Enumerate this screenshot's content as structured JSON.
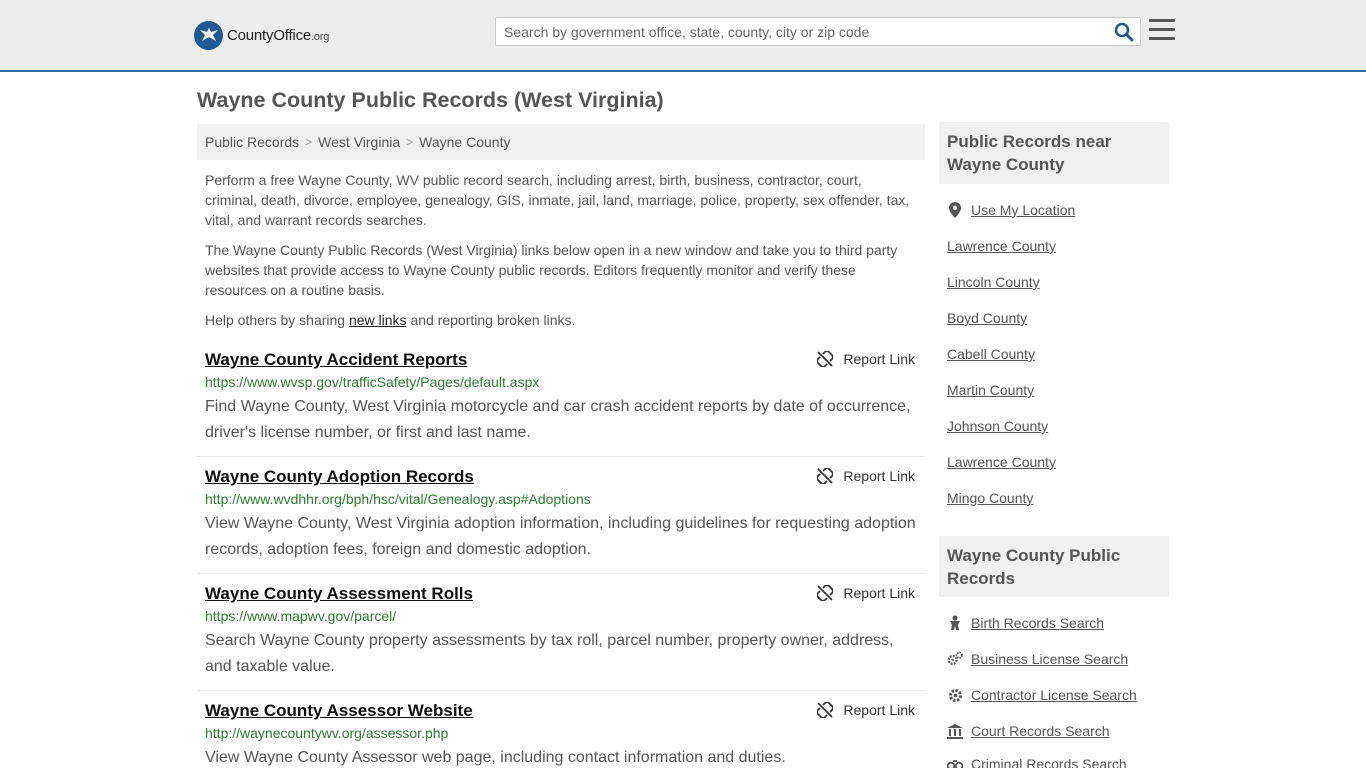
{
  "header": {
    "logo_county": "County",
    "logo_office": "Office",
    "logo_org": ".org",
    "search_placeholder": "Search by government office, state, county, city or zip code"
  },
  "page": {
    "title": "Wayne County Public Records (West Virginia)"
  },
  "breadcrumb": [
    "Public Records",
    "West Virginia",
    "Wayne County"
  ],
  "intro": {
    "p1": "Perform a free Wayne County, WV public record search, including arrest, birth, business, contractor, court, criminal, death, divorce, employee, genealogy, GIS, inmate, jail, land, marriage, police, property, sex offender, tax, vital, and warrant records searches.",
    "p2": "The Wayne County Public Records (West Virginia) links below open in a new window and take you to third party websites that provide access to Wayne County public records. Editors frequently monitor and verify these resources on a routine basis.",
    "p3_before": "Help others by sharing ",
    "p3_link": "new links",
    "p3_after": " and reporting broken links."
  },
  "report_label": "Report Link",
  "records": [
    {
      "title": "Wayne County Accident Reports",
      "url": "https://www.wvsp.gov/trafficSafety/Pages/default.aspx",
      "desc": "Find Wayne County, West Virginia motorcycle and car crash accident reports by date of occurrence, driver's license number, or first and last name."
    },
    {
      "title": "Wayne County Adoption Records",
      "url": "http://www.wvdhhr.org/bph/hsc/vital/Genealogy.asp#Adoptions",
      "desc": "View Wayne County, West Virginia adoption information, including guidelines for requesting adoption records, adoption fees, foreign and domestic adoption."
    },
    {
      "title": "Wayne County Assessment Rolls",
      "url": "https://www.mapwv.gov/parcel/",
      "desc": "Search Wayne County property assessments by tax roll, parcel number, property owner, address, and taxable value."
    },
    {
      "title": "Wayne County Assessor Website",
      "url": "http://waynecountywv.org/assessor.php",
      "desc": "View Wayne County Assessor web page, including contact information and duties."
    }
  ],
  "sidebar": {
    "near_title": "Public Records near Wayne County",
    "use_location": "Use My Location",
    "near_links": [
      "Lawrence County",
      "Lincoln County",
      "Boyd County",
      "Cabell County",
      "Martin County",
      "Johnson County",
      "Lawrence County",
      "Mingo County"
    ],
    "county_title": "Wayne County Public Records",
    "county_links": [
      {
        "label": "Birth Records Search",
        "icon": "baby-icon"
      },
      {
        "label": "Business License Search",
        "icon": "gears-icon"
      },
      {
        "label": "Contractor License Search",
        "icon": "gear-icon"
      },
      {
        "label": "Court Records Search",
        "icon": "courthouse-icon"
      },
      {
        "label": "Criminal Records Search",
        "icon": "handcuffs-icon"
      }
    ]
  }
}
